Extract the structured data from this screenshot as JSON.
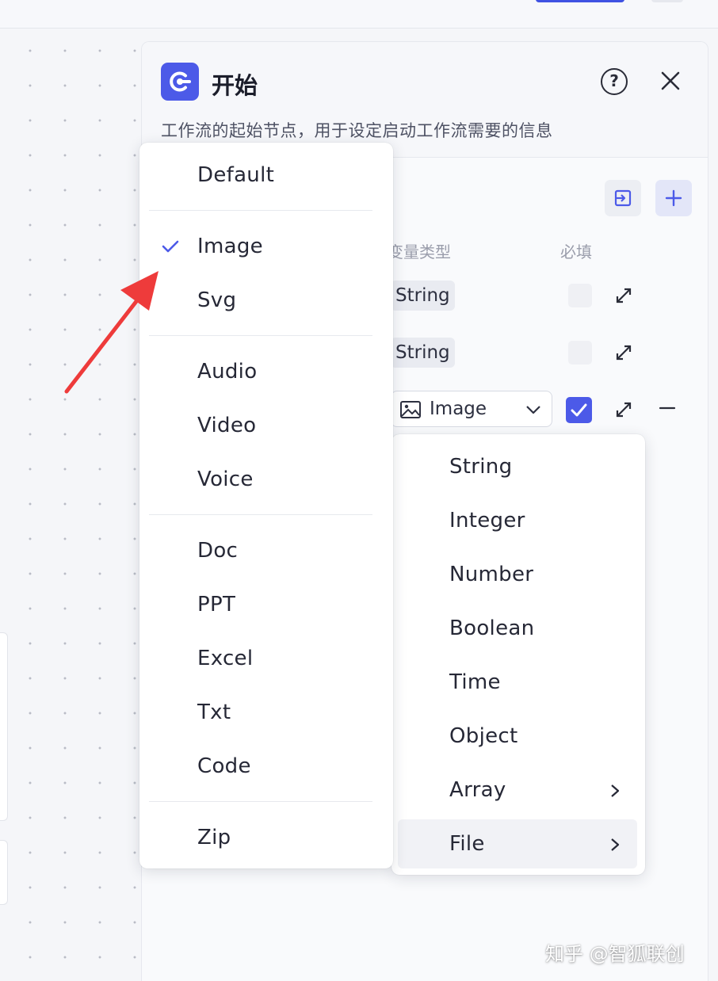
{
  "node": {
    "title": "开始",
    "description": "工作流的起始节点，用于设定启动工作流需要的信息",
    "help_symbol": "?",
    "accent_color": "#4c5ae8"
  },
  "table": {
    "columns": [
      "变量类型",
      "必填"
    ],
    "rows": [
      {
        "type": "String",
        "required": false
      },
      {
        "type": "String",
        "required": false
      },
      {
        "type": "Image",
        "required": true
      }
    ]
  },
  "type_menu": {
    "items": [
      {
        "label": "String",
        "has_submenu": false
      },
      {
        "label": "Integer",
        "has_submenu": false
      },
      {
        "label": "Number",
        "has_submenu": false
      },
      {
        "label": "Boolean",
        "has_submenu": false
      },
      {
        "label": "Time",
        "has_submenu": false
      },
      {
        "label": "Object",
        "has_submenu": false
      },
      {
        "label": "Array",
        "has_submenu": true
      },
      {
        "label": "File",
        "has_submenu": true,
        "highlighted": true
      }
    ]
  },
  "file_menu": {
    "groups": [
      [
        "Default"
      ],
      [
        "Image",
        "Svg"
      ],
      [
        "Audio",
        "Video",
        "Voice"
      ],
      [
        "Doc",
        "PPT",
        "Excel",
        "Txt",
        "Code"
      ],
      [
        "Zip"
      ]
    ],
    "selected": "Image"
  },
  "icons": {
    "node": "start-node-icon",
    "help": "help-icon",
    "close": "close-icon",
    "import": "import-icon",
    "add": "plus-icon",
    "expand": "expand-icon",
    "image_type": "image-icon",
    "dropdown": "chevron-down-icon",
    "checkbox": "checkmark-icon",
    "remove": "minus-icon",
    "submenu": "chevron-right-icon",
    "selected": "checkmark-icon",
    "annotation": "red-arrow-icon"
  },
  "annotation_color": "#ee3b3b",
  "watermark": "知乎 @智狐联创"
}
